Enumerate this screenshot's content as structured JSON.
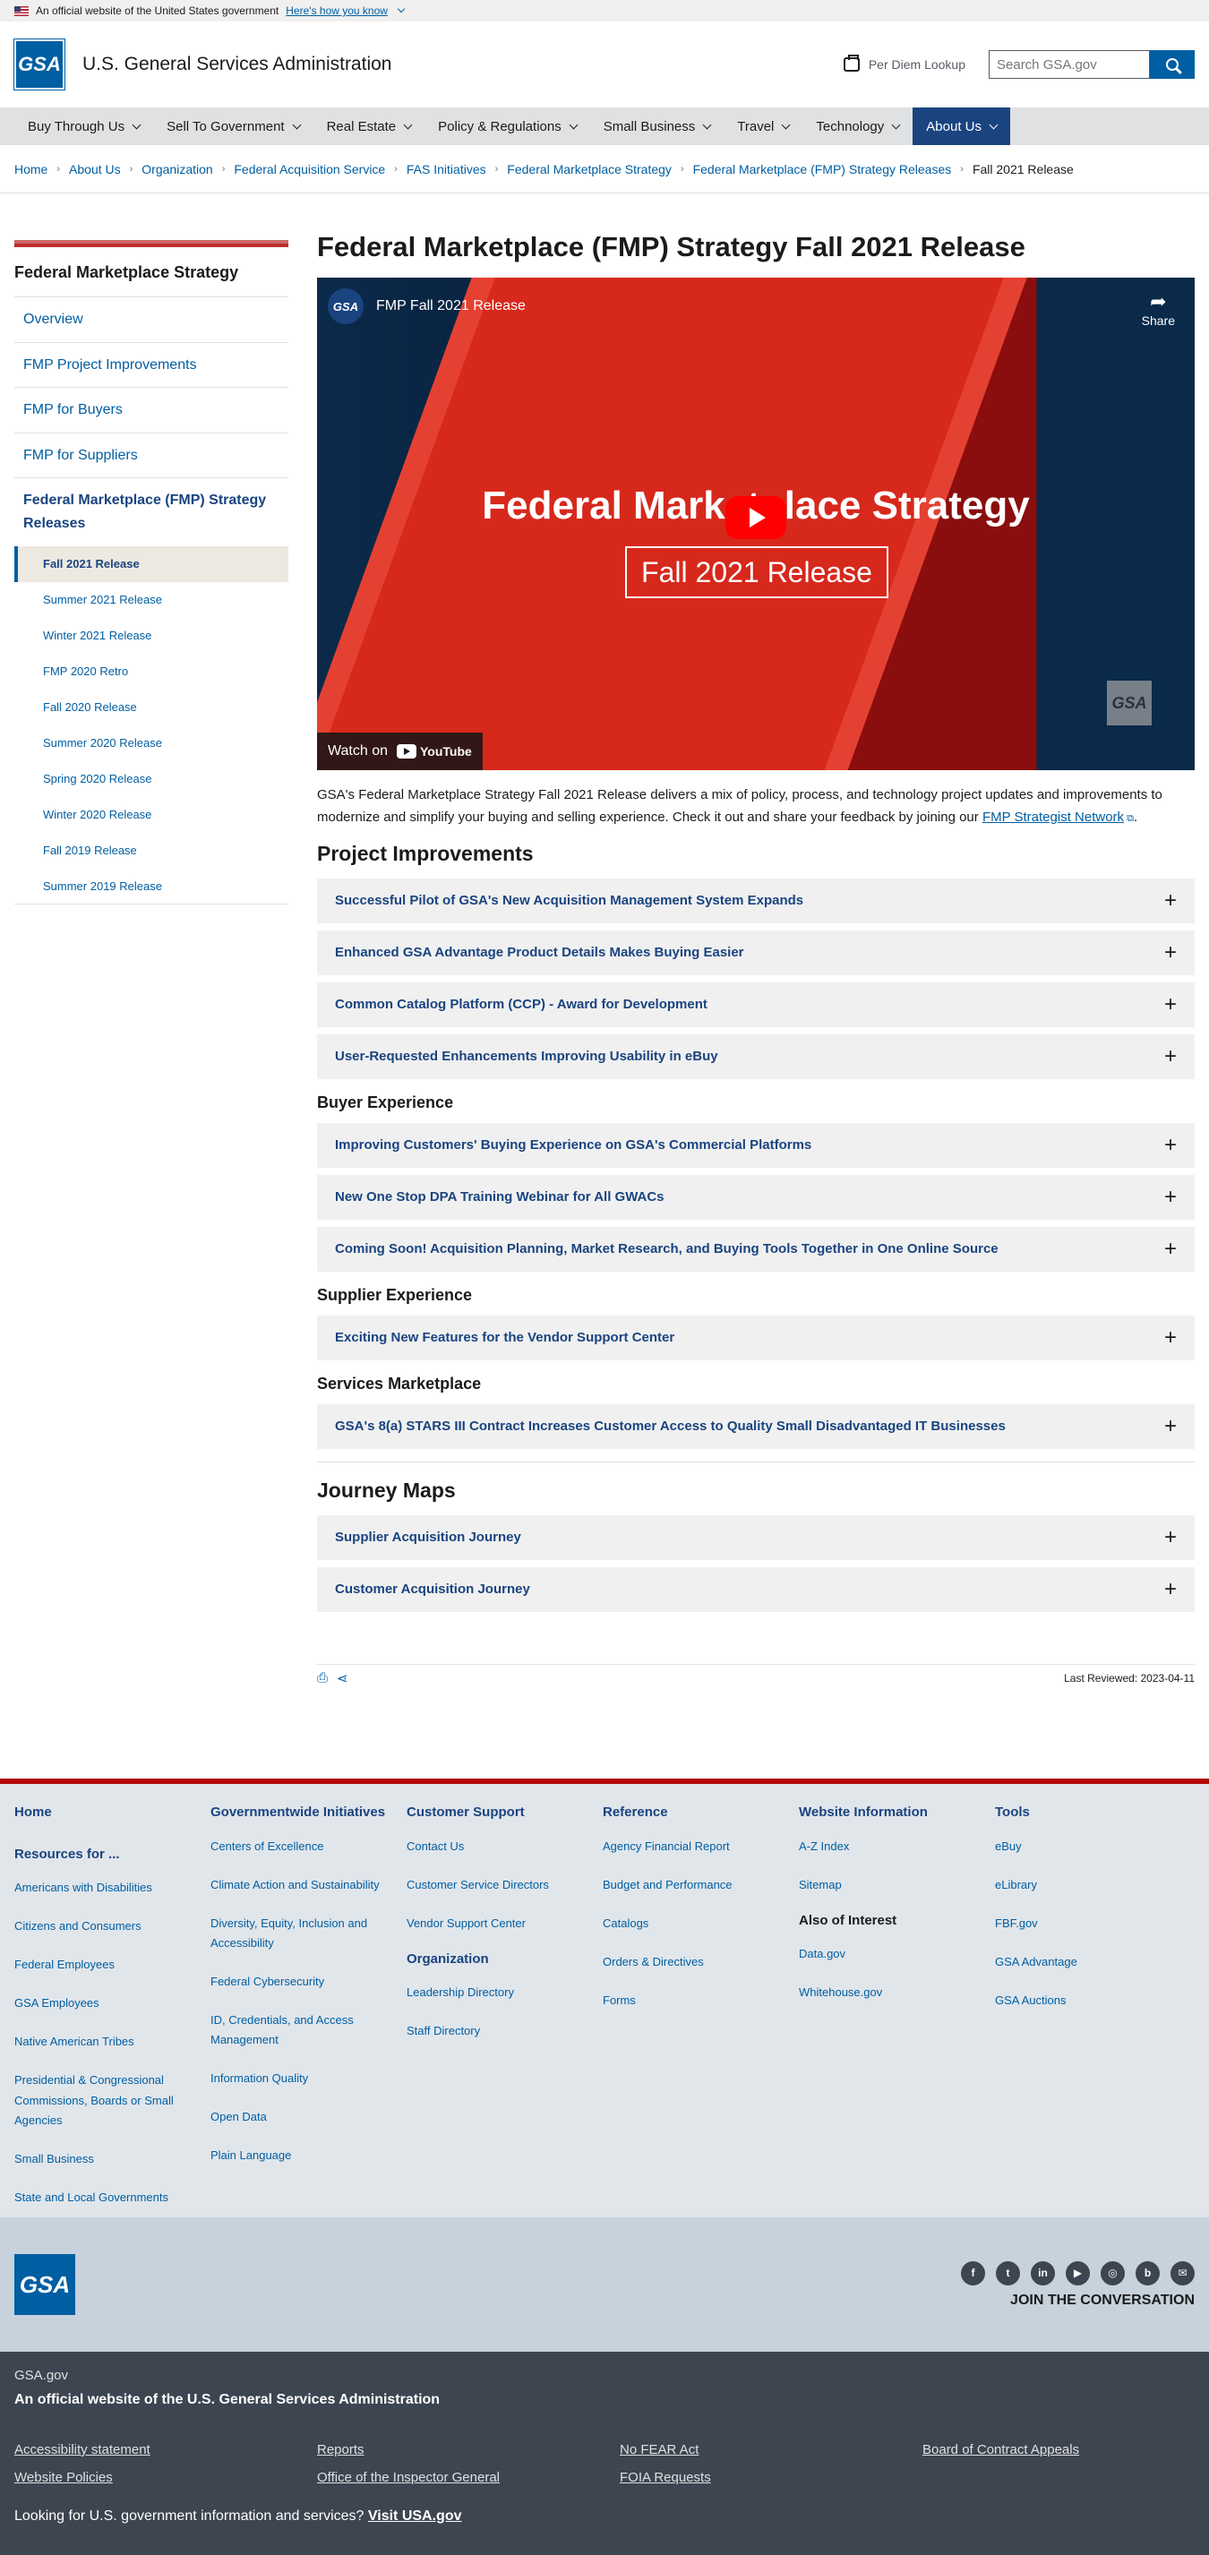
{
  "banner": {
    "official": "An official website of the United States government",
    "how": "Here's how you know"
  },
  "header": {
    "logo": "GSA",
    "agency": "U.S. General Services Administration",
    "per_diem": "Per Diem Lookup",
    "search_placeholder": "Search GSA.gov"
  },
  "nav": [
    "Buy Through Us",
    "Sell To Government",
    "Real Estate",
    "Policy & Regulations",
    "Small Business",
    "Travel",
    "Technology",
    "About Us"
  ],
  "breadcrumb": [
    "Home",
    "About Us",
    "Organization",
    "Federal Acquisition Service",
    "FAS Initiatives",
    "Federal Marketplace Strategy",
    "Federal Marketplace (FMP) Strategy Releases",
    "Fall 2021 Release"
  ],
  "sidebar": {
    "title": "Federal Marketplace Strategy",
    "items": [
      "Overview",
      "FMP Project Improvements",
      "FMP for Buyers",
      "FMP for Suppliers",
      "Federal Marketplace (FMP) Strategy Releases"
    ],
    "subitems": [
      "Fall 2021 Release",
      "Summer 2021 Release",
      "Winter 2021 Release",
      "FMP 2020 Retro",
      "Fall 2020 Release",
      "Summer 2020 Release",
      "Spring 2020 Release",
      "Winter 2020 Release",
      "Fall 2019 Release",
      "Summer 2019 Release"
    ]
  },
  "page": {
    "title": "Federal Marketplace (FMP) Strategy Fall 2021 Release",
    "video": {
      "channel_logo": "GSA",
      "title": "FMP Fall 2021 Release",
      "share": "Share",
      "headline": "Federal Marketplace Strategy",
      "sub": "Fall 2021 Release",
      "watch_on": "Watch on",
      "youtube": "YouTube",
      "watermark": "GSA"
    },
    "intro": "GSA's Federal Marketplace Strategy Fall 2021 Release delivers a mix of policy, process, and technology project updates and improvements to modernize and simplify your buying and selling experience. Check it out and share your feedback by joining our ",
    "intro_link": "FMP Strategist Network",
    "sections": {
      "project": {
        "title": "Project Improvements",
        "items": [
          "Successful Pilot of GSA's New Acquisition Management System Expands",
          "Enhanced GSA Advantage Product Details Makes Buying Easier",
          "Common Catalog Platform (CCP) - Award for Development",
          "User-Requested Enhancements Improving Usability in eBuy"
        ]
      },
      "buyer": {
        "title": "Buyer Experience",
        "items": [
          "Improving Customers' Buying Experience on GSA's Commercial Platforms",
          "New One Stop DPA Training Webinar for All GWACs",
          "Coming Soon! Acquisition Planning, Market Research, and Buying Tools Together in One Online Source"
        ]
      },
      "supplier": {
        "title": "Supplier Experience",
        "items": [
          "Exciting New Features for the Vendor Support Center"
        ]
      },
      "services": {
        "title": "Services Marketplace",
        "items": [
          "GSA's 8(a) STARS III Contract Increases Customer Access to Quality Small Disadvantaged IT Businesses"
        ]
      },
      "journey": {
        "title": "Journey Maps",
        "items": [
          "Supplier Acquisition Journey",
          "Customer Acquisition Journey"
        ]
      }
    },
    "last_reviewed": "Last Reviewed: 2023-04-11"
  },
  "footer": {
    "col1": {
      "home": "Home",
      "head": "Resources for ...",
      "links": [
        "Americans with Disabilities",
        "Citizens and Consumers",
        "Federal Employees",
        "GSA Employees",
        "Native American Tribes",
        "Presidential & Congressional Commissions, Boards or Small Agencies",
        "Small Business",
        "State and Local Governments"
      ]
    },
    "col2": {
      "head": "Governmentwide Initiatives",
      "links": [
        "Centers of Excellence",
        "Climate Action and Sustainability",
        "Diversity, Equity, Inclusion and Accessibility",
        "Federal Cybersecurity",
        "ID, Credentials, and Access Management",
        "Information Quality",
        "Open Data",
        "Plain Language"
      ]
    },
    "col3": {
      "head": "Customer Support",
      "links": [
        "Contact Us",
        "Customer Service Directors",
        "Vendor Support Center"
      ],
      "head2": "Organization",
      "links2": [
        "Leadership Directory",
        "Staff Directory"
      ]
    },
    "col4": {
      "head": "Reference",
      "links": [
        "Agency Financial Report",
        "Budget and Performance",
        "Catalogs",
        "Orders & Directives",
        "Forms"
      ]
    },
    "col5": {
      "head": "Website Information",
      "links": [
        "A-Z Index",
        "Sitemap"
      ],
      "head2": "Also of Interest",
      "links2": [
        "Data.gov",
        "Whitehouse.gov"
      ]
    },
    "col6": {
      "head": "Tools",
      "links": [
        "eBuy",
        "eLibrary",
        "FBF.gov",
        "GSA Advantage",
        "GSA Auctions"
      ]
    }
  },
  "social": {
    "logo": "GSA",
    "join": "JOIN THE CONVERSATION",
    "icons": [
      "facebook-icon",
      "twitter-icon",
      "linkedin-icon",
      "youtube-icon",
      "instagram-icon",
      "blog-icon",
      "email-icon"
    ]
  },
  "bottom": {
    "gov": "GSA.gov",
    "official": "An official website of the U.S. General Services Administration",
    "links": [
      "Accessibility statement",
      "Reports",
      "No FEAR Act",
      "Board of Contract Appeals",
      "Website Policies",
      "Office of the Inspector General",
      "FOIA Requests"
    ],
    "looking": "Looking for U.S. government information and services? ",
    "usa": "Visit USA.gov"
  }
}
